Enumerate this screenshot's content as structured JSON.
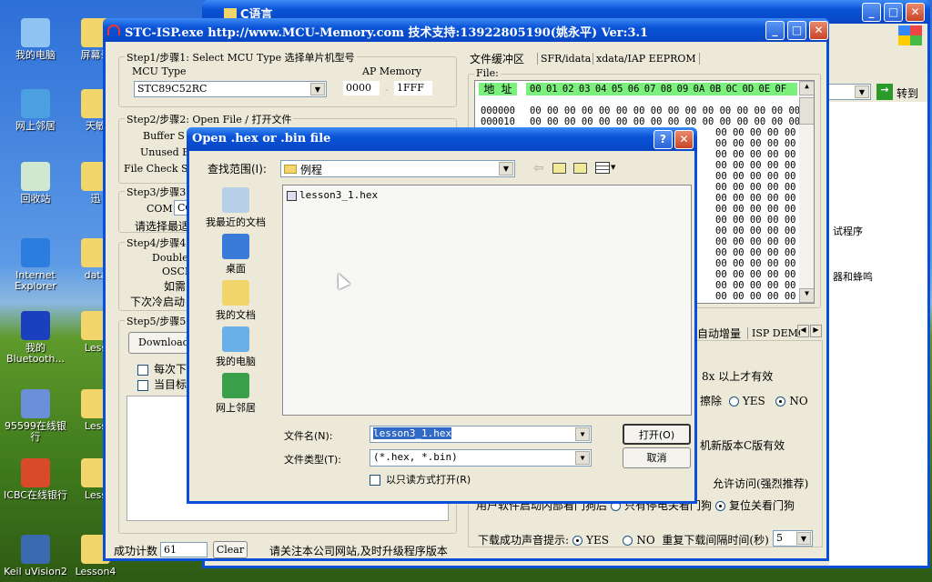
{
  "desktop": {
    "icons_col1": [
      "我的电脑",
      "网上邻居",
      "回收站",
      "Internet Explorer",
      "我的 Bluetooth...",
      "95599在线银行",
      "ICBC在线银行",
      "Keil uVision2"
    ],
    "icons_col2": [
      "屏幕录",
      "天敏",
      "迅",
      "data",
      "Less",
      "Less",
      "Less",
      "Lesson4"
    ]
  },
  "explorer": {
    "title": "C语言",
    "go_label": "转到",
    "partial_text_1": "试程序",
    "partial_text_2": "器和蜂鸣"
  },
  "stc": {
    "title": "STC-ISP.exe http://www.MCU-Memory.com 技术支持:13922805190(姚永平) Ver:3.1",
    "step1": {
      "legend": "Step1/步骤1: Select MCU Type  选择单片机型号",
      "mcu_label": "MCU Type",
      "mcu_value": "STC89C52RC",
      "ap_label": "AP Memory",
      "ap_start": "0000",
      "ap_sep": "-",
      "ap_end": "1FFF"
    },
    "step2": {
      "legend": "Step2/步骤2: Open File / 打开文件",
      "buffer": "Buffer S",
      "unused": "Unused By",
      "check": "File Check S"
    },
    "step3": {
      "legend": "Step3/步骤3",
      "com_label": "COM:",
      "com_value": "CO",
      "hint": "请选择最适"
    },
    "step4": {
      "legend": "Step4/步骤4",
      "double": "Double",
      "oscdn": "OSCDN",
      "need": "如需",
      "next": "下次冷启动"
    },
    "step5": {
      "legend": "Step5/步骤5",
      "download": "Download/",
      "check1": "每次下",
      "check2": "当目标"
    },
    "status": {
      "count_label": "成功计数",
      "count_value": "61",
      "clear_label": "Clear",
      "notice": "请关注本公司网站,及时升级程序版本"
    },
    "tabs": [
      "文件缓冲区",
      "SFR/idata",
      "xdata/IAP EEPROM"
    ],
    "file_legend": "File:",
    "hex_header_addr": "地 址",
    "hex_header_cols": "00 01 02 03 04 05 06 07 08 09 0A 0B 0C 0D 0E 0F",
    "hex_rows": [
      {
        "addr": "000000",
        "bytes": "00 00 00 00 00 00 00 00 00 00 00 00 00 00 00 00"
      },
      {
        "addr": "000010",
        "bytes": "00 00 00 00 00 00 00 00 00 00 00 00 00 00 00 00"
      },
      {
        "addr": "",
        "bytes": "00 00 00 00 00"
      },
      {
        "addr": "",
        "bytes": "00 00 00 00 00"
      },
      {
        "addr": "",
        "bytes": "00 00 00 00 00"
      },
      {
        "addr": "",
        "bytes": "00 00 00 00 00"
      },
      {
        "addr": "",
        "bytes": "00 00 00 00 00"
      },
      {
        "addr": "",
        "bytes": "00 00 00 00 00"
      },
      {
        "addr": "",
        "bytes": "00 00 00 00 00"
      },
      {
        "addr": "",
        "bytes": "00 00 00 00 00"
      },
      {
        "addr": "",
        "bytes": "00 00 00 00 00"
      },
      {
        "addr": "",
        "bytes": "00 00 00 00 00"
      },
      {
        "addr": "",
        "bytes": "00 00 00 00 00"
      },
      {
        "addr": "",
        "bytes": "00 00 00 00 00"
      },
      {
        "addr": "",
        "bytes": "00 00 00 00 00"
      },
      {
        "addr": "",
        "bytes": "00 00 00 00 00"
      },
      {
        "addr": "",
        "bytes": "00 00 00 00 00"
      },
      {
        "addr": "",
        "bytes": "00 00 00 00 00"
      }
    ],
    "lower_tabs": [
      "自动增量",
      "ISP DEMO"
    ],
    "opt1": "8x 以上才有效",
    "opt2_label": "擦除",
    "yes": "YES",
    "no": "NO",
    "opt3": "机新版本C版有效",
    "opt4": "允许访问(强烈推荐)",
    "opt5_a": "用户软件启动内部看门狗后",
    "opt5_b": "只有停电关看门狗",
    "opt5_c": "复位关看门狗",
    "beep_label": "下载成功声音提示:",
    "beep_yes": "YES",
    "beep_no": "NO",
    "interval_label": "重复下载间隔时间(秒)",
    "interval_value": "5"
  },
  "dialog": {
    "title": "Open .hex or .bin file",
    "lookin_label": "查找范围(I):",
    "lookin_value": "例程",
    "places": [
      "我最近的文档",
      "桌面",
      "我的文档",
      "我的电脑",
      "网上邻居"
    ],
    "files": [
      "lesson3_1.hex"
    ],
    "filename_label": "文件名(N):",
    "filename_value": "lesson3_1.hex",
    "filetype_label": "文件类型(T):",
    "filetype_value": "(*.hex, *.bin)",
    "readonly_label": "以只读方式打开(R)",
    "open_label": "打开(O)",
    "cancel_label": "取消"
  },
  "colors": {
    "titlebar": "#0a53d6",
    "hex_header": "#7cf07c",
    "face": "#ece9d8"
  }
}
